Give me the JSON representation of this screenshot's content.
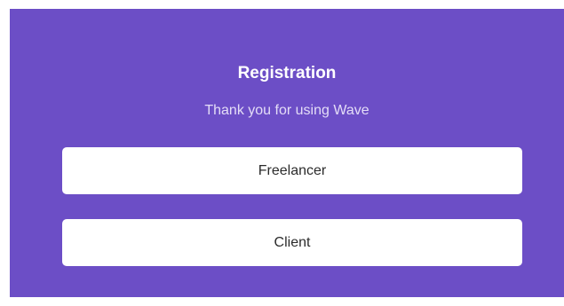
{
  "registration": {
    "title": "Registration",
    "subtitle": "Thank you for using Wave",
    "options": {
      "freelancer_label": "Freelancer",
      "client_label": "Client"
    },
    "colors": {
      "panel_background": "#6c4ec6",
      "button_background": "#ffffff",
      "button_text": "#2b2b2b",
      "title_text": "#ffffff"
    }
  }
}
